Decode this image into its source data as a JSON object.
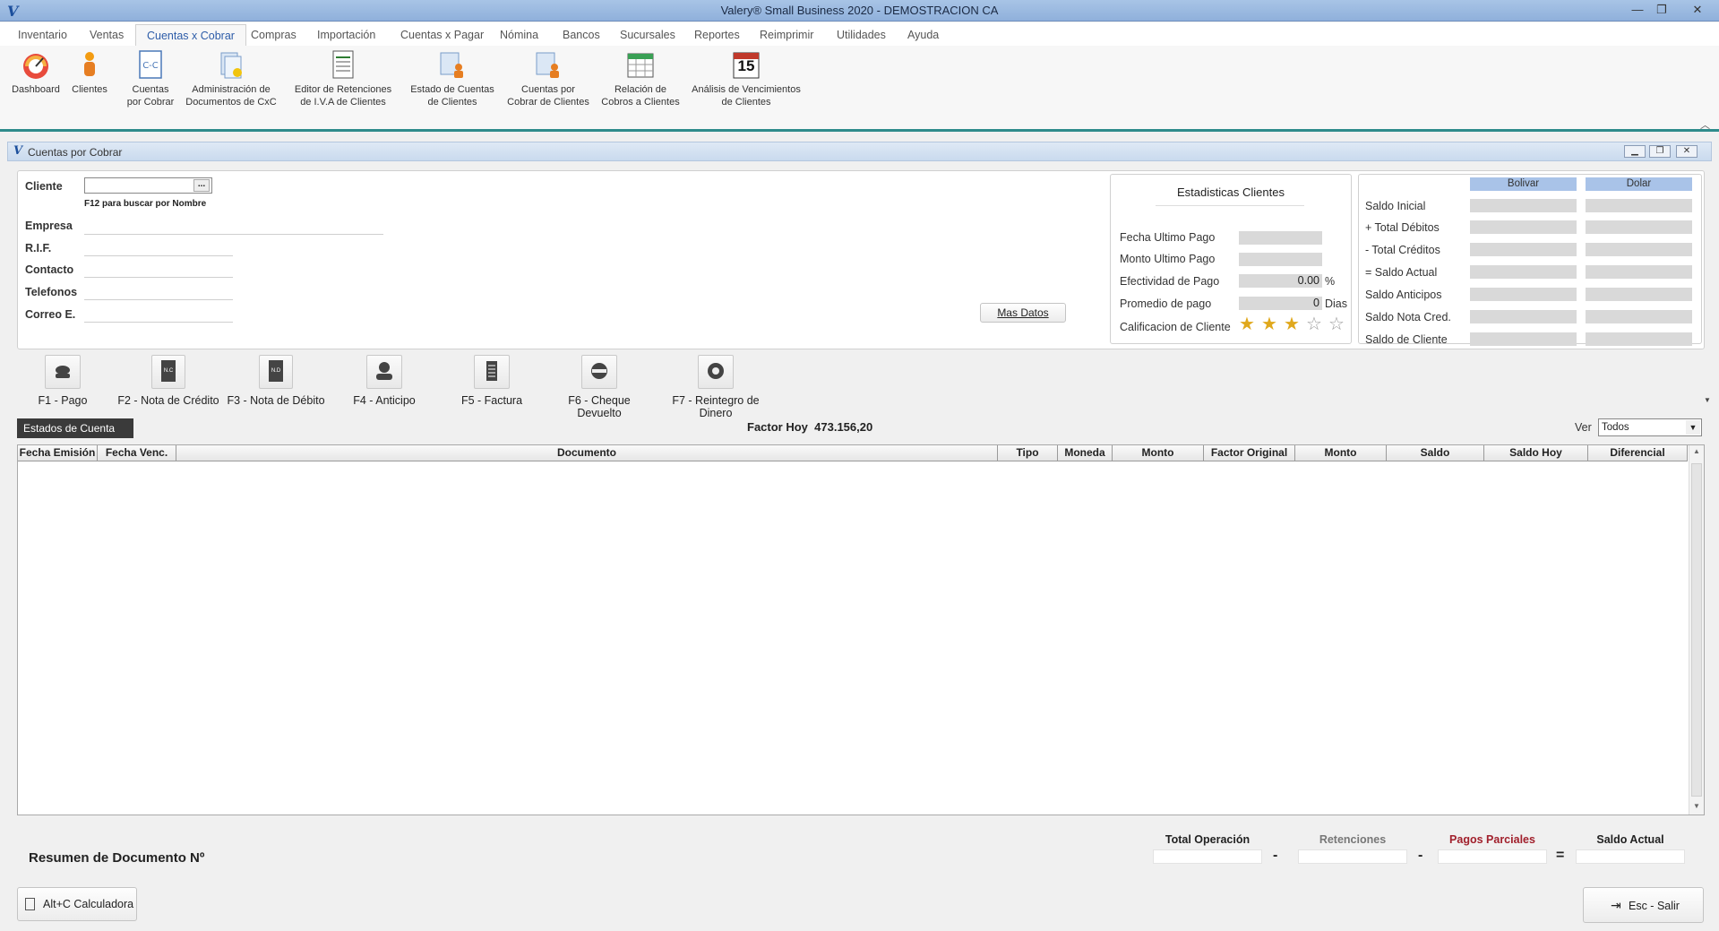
{
  "window": {
    "title": "Valery® Small Business 2020 - DEMOSTRACION CA"
  },
  "menu": {
    "items": [
      "Inventario",
      "Ventas",
      "Cuentas x Cobrar",
      "Compras",
      "Importación",
      "Cuentas x Pagar",
      "Nómina",
      "Bancos",
      "Sucursales",
      "Reportes",
      "Reimprimir",
      "Utilidades",
      "Ayuda"
    ],
    "active": "Cuentas x Cobrar"
  },
  "ribbon": {
    "dashboard": {
      "l1": "Dashboard",
      "l2": ""
    },
    "clientes": {
      "l1": "Clientes",
      "l2": ""
    },
    "cxc": {
      "l1": "Cuentas",
      "l2": "por Cobrar"
    },
    "admin": {
      "l1": "Administración de",
      "l2": "Documentos de CxC"
    },
    "editor": {
      "l1": "Editor de Retenciones",
      "l2": "de I.V.A de Clientes"
    },
    "estado": {
      "l1": "Estado de Cuentas",
      "l2": "de Clientes"
    },
    "cuentas_clientes": {
      "l1": "Cuentas por",
      "l2": "Cobrar de Clientes"
    },
    "relacion": {
      "l1": "Relación de",
      "l2": "Cobros a Clientes"
    },
    "analisis": {
      "l1": "Análisis de Vencimientos",
      "l2": "de Clientes"
    },
    "calendar_day": "15"
  },
  "child": {
    "title": "Cuentas por Cobrar"
  },
  "client_form": {
    "cliente_label": "Cliente",
    "cliente_value": "",
    "browse": "...",
    "hint": "F12 para buscar por Nombre",
    "empresa_label": "Empresa",
    "rif_label": "R.I.F.",
    "contacto_label": "Contacto",
    "telefonos_label": "Telefonos",
    "correo_label": "Correo E.",
    "mas_datos": "Mas Datos"
  },
  "stats": {
    "title": "Estadisticas Clientes",
    "fecha_ultimo_pago": "Fecha Ultimo Pago",
    "monto_ultimo_pago": "Monto Ultimo Pago",
    "efectividad": "Efectividad de Pago",
    "efectividad_value": "0.00",
    "efectividad_unit": "%",
    "promedio": "Promedio de pago",
    "promedio_value": "0",
    "promedio_unit": "Dias",
    "calificacion": "Calificacion de Cliente",
    "rating": 3,
    "rating_max": 5
  },
  "balances": {
    "col_bolivar": "Bolivar",
    "col_dolar": "Dolar",
    "rows": [
      "Saldo Inicial",
      "+ Total Débitos",
      "-  Total Créditos",
      "= Saldo Actual",
      "Saldo Anticipos",
      "Saldo Nota Cred.",
      "Saldo de Cliente"
    ]
  },
  "actions": {
    "f1": "F1 - Pago",
    "f2": "F2 - Nota de Crédito",
    "f3": "F3 - Nota de Débito",
    "f4": "F4 - Anticipo",
    "f5": "F5 - Factura",
    "f6": "F6 - Cheque Devuelto",
    "f7": "F7 - Reintegro de Dinero",
    "nc": "N.C",
    "nd": "N.D"
  },
  "estados": {
    "tab": "Estados de Cuenta",
    "factor_label": "Factor Hoy",
    "factor_value": "473.156,20",
    "ver_label": "Ver",
    "ver_value": "Todos"
  },
  "grid": {
    "columns": [
      "Fecha Emisión",
      "Fecha Venc.",
      "Documento",
      "Tipo",
      "Moneda",
      "Monto",
      "Factor Original",
      "Monto",
      "Saldo",
      "Saldo Hoy",
      "Diferencial"
    ],
    "rows": []
  },
  "summary": {
    "resumen": "Resumen de Documento Nº",
    "total_operacion": "Total Operación",
    "retenciones": "Retenciones",
    "pagos_parciales": "Pagos Parciales",
    "saldo_actual": "Saldo Actual",
    "minus": "-",
    "equals": "="
  },
  "footer": {
    "calculadora": "Alt+C Calculadora",
    "salir": "Esc - Salir"
  },
  "colors": {
    "accent": "#2d5ca8",
    "ribbon_line": "#2e8b8b",
    "pagos_parciales": "#a1202c",
    "header_blue": "#a9c3e8"
  }
}
